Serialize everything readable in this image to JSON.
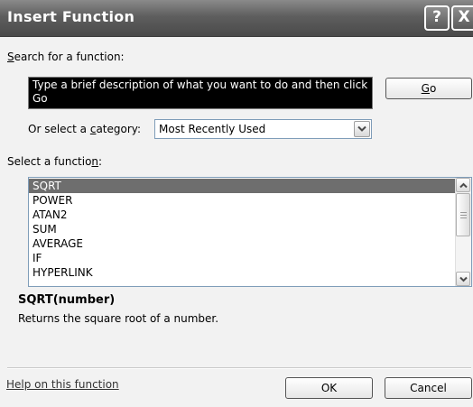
{
  "window": {
    "title": "Insert Function",
    "help_glyph": "?",
    "close_glyph": "X"
  },
  "search": {
    "label_prefix": "",
    "label_access": "S",
    "label_rest": "earch for a function:",
    "value": "Type a brief description of what you want to do and then click Go",
    "go_access": "G",
    "go_rest": "o"
  },
  "category": {
    "label_prefix": "Or select a ",
    "label_access": "c",
    "label_rest": "ategory:",
    "selected": "Most Recently Used"
  },
  "functions": {
    "label_prefix": "Select a functio",
    "label_access": "n",
    "label_rest": ":",
    "items": [
      "SQRT",
      "POWER",
      "ATAN2",
      "SUM",
      "AVERAGE",
      "IF",
      "HYPERLINK"
    ],
    "selected_index": 0,
    "scroll_position": 0
  },
  "details": {
    "syntax": "SQRT(number)",
    "description": "Returns the square root of a number."
  },
  "footer": {
    "help_link": "Help on this function",
    "ok_label": "OK",
    "cancel_label": "Cancel"
  },
  "colors": {
    "titlebar": "#5e5e5e",
    "selection": "#6e6e6e",
    "search_bg": "#000000",
    "dialog_bg": "#f2f2f2"
  },
  "icons": {
    "help": "question-mark-icon",
    "close": "close-icon",
    "combo": "chevron-down-icon",
    "scroll_up": "chevron-up-icon",
    "scroll_down": "chevron-down-icon"
  }
}
